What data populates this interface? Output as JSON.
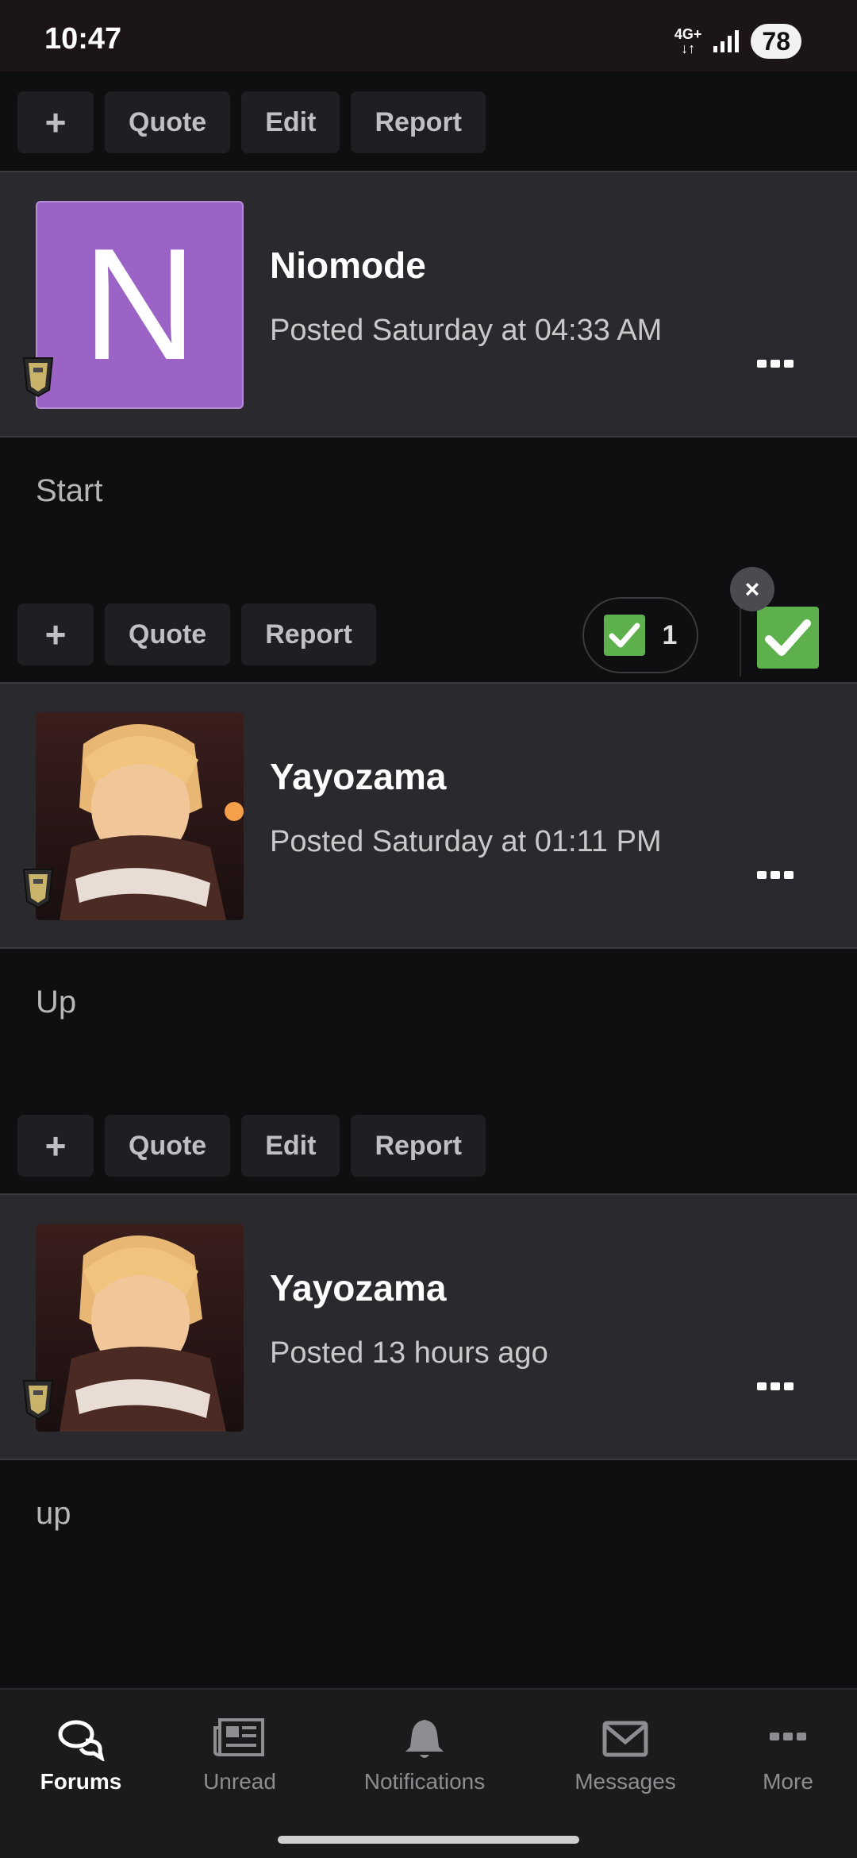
{
  "status_bar": {
    "time": "10:47",
    "network": "4G+",
    "battery": "78"
  },
  "actions": {
    "plus": "+",
    "quote": "Quote",
    "edit": "Edit",
    "report": "Report"
  },
  "posts": [
    {
      "author": "Niomode",
      "avatar_letter": "N",
      "posted": "Posted Saturday at 04:33 AM",
      "body": "Start"
    },
    {
      "author": "Yayozama",
      "posted": "Posted Saturday at 01:11 PM",
      "body": "Up"
    },
    {
      "author": "Yayozama",
      "posted": "Posted 13 hours ago",
      "body": "up"
    }
  ],
  "reaction": {
    "count": "1",
    "close": "×"
  },
  "nav": [
    {
      "label": "Forums",
      "icon": "forums-icon",
      "active": true
    },
    {
      "label": "Unread",
      "icon": "unread-icon"
    },
    {
      "label": "Notifications",
      "icon": "bell-icon"
    },
    {
      "label": "Messages",
      "icon": "envelope-icon"
    },
    {
      "label": "More",
      "icon": "more-icon"
    }
  ],
  "colors": {
    "accent_green": "#5db04c",
    "avatar_purple": "#9b63c6",
    "header_bg": "#2a2a2e"
  }
}
